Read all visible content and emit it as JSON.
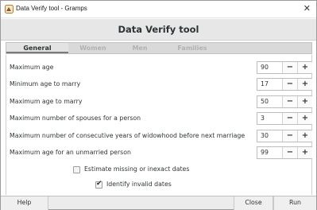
{
  "window": {
    "title": "Data Verify tool - Gramps",
    "close_glyph": "✕",
    "app_icon": "gramps-icon"
  },
  "header": {
    "title": "Data Verify tool"
  },
  "tabs": [
    {
      "label": "General",
      "active": true
    },
    {
      "label": "Women",
      "active": false
    },
    {
      "label": "Men",
      "active": false
    },
    {
      "label": "Families",
      "active": false
    }
  ],
  "settings": [
    {
      "label": "Maximum age",
      "value": "90"
    },
    {
      "label": "Minimum age to marry",
      "value": "17"
    },
    {
      "label": "Maximum age to marry",
      "value": "50"
    },
    {
      "label": "Maximum number of spouses for a person",
      "value": "3"
    },
    {
      "label": "Maximum number of consecutive years of widowhood before next marriage",
      "value": "30"
    },
    {
      "label": "Maximum age for an unmarried person",
      "value": "99"
    }
  ],
  "spin": {
    "minus": "−",
    "plus": "+"
  },
  "checks": [
    {
      "label": "Estimate missing or inexact dates",
      "checked": false
    },
    {
      "label": "Identify invalid dates",
      "checked": true
    }
  ],
  "footer": {
    "help": "Help",
    "close": "Close",
    "run": "Run"
  },
  "colors": {
    "header_bg": "#e7e7e7",
    "tab_bar_bg": "#d9d9d9",
    "text": "#2e3436"
  }
}
